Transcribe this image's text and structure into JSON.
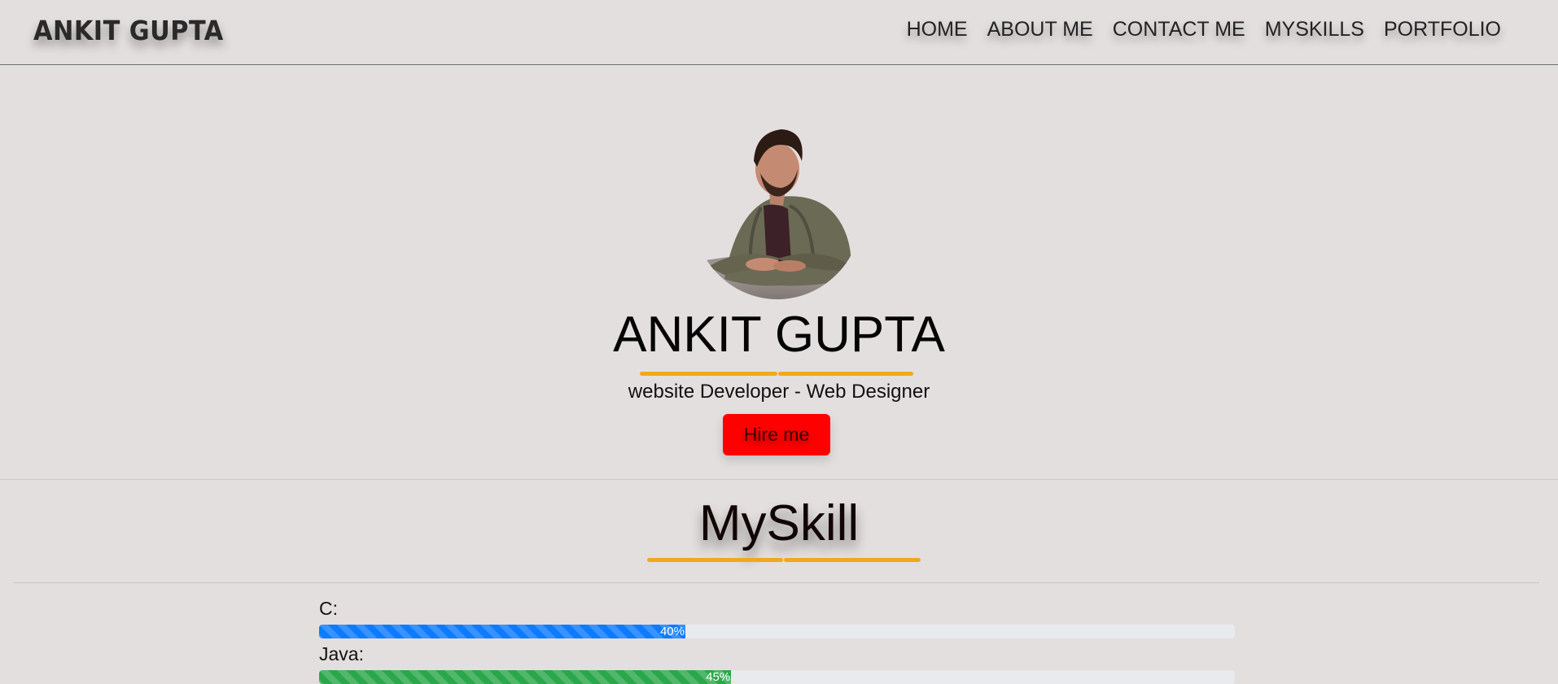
{
  "header": {
    "brand": "ANKIT GUPTA",
    "nav": [
      "HOME",
      "ABOUT ME",
      "CONTACT ME",
      "MYSKILLS",
      "PORTFOLIO"
    ]
  },
  "hero": {
    "name": "ANKIT GUPTA",
    "subtitle": "website Developer - Web Designer",
    "cta_label": "Hire me",
    "accent_color": "#f0a91c",
    "cta_color": "#ff0000"
  },
  "skills": {
    "title": "MySkill",
    "items": [
      {
        "label": "C:",
        "percent_text": "40%",
        "value": 40,
        "color": "#0b7bff"
      },
      {
        "label": "Java:",
        "percent_text": "45%",
        "value": 45,
        "color": "#2aa74b"
      }
    ]
  }
}
